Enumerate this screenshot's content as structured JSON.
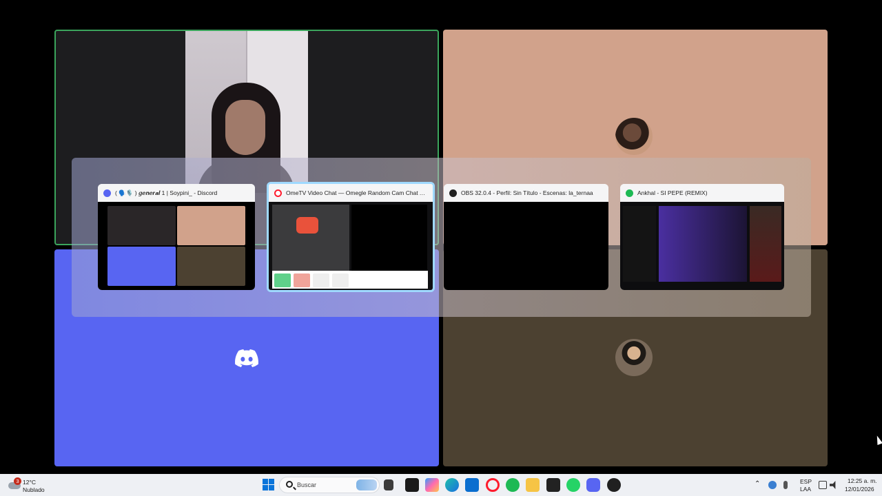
{
  "call": {
    "tiles": [
      {
        "name": "participant-camera",
        "color": "#1d1d1f",
        "speaking_outline": "#3ba55c"
      },
      {
        "name": "participant-avatar-pixel",
        "color": "#d1a28b"
      },
      {
        "name": "participant-discord-default",
        "color": "#5865f2"
      },
      {
        "name": "participant-avatar-glasses",
        "color": "#4c4131"
      }
    ]
  },
  "switcher": {
    "windows": [
      {
        "title": "( 🗣️🎙️ ) 𝒈𝒆𝒏𝒆𝒓𝒂𝒍 1 | Soypini_ - Discord",
        "icon": "discord-icon",
        "icon_color": "#5865f2",
        "selected": false
      },
      {
        "title": "OmeTV Video Chat — Omegle Random Cam Chat Alter...",
        "icon": "opera-icon",
        "icon_color": "#ff1b2d",
        "selected": true
      },
      {
        "title": "OBS 32.0.4 - Perfil: Sin Título - Escenas: la_ternaa",
        "icon": "obs-icon",
        "icon_color": "#202020",
        "selected": false
      },
      {
        "title": "Ankhal - SI PEPE (REMIX)",
        "icon": "spotify-icon",
        "icon_color": "#1db954",
        "selected": false
      }
    ],
    "ometv_thumb": {
      "logo_text": "Ome",
      "logo_sub": "TV"
    }
  },
  "taskbar": {
    "weather": {
      "temp": "12°C",
      "condition": "Nublado",
      "notif_count": "3"
    },
    "search_placeholder": "Buscar",
    "pinned": [
      "start-icon",
      "search-icon",
      "file-explorer-icon",
      "capcut-icon",
      "copilot-icon",
      "edge-icon",
      "microsoft-store-icon",
      "opera-icon",
      "spotify-icon",
      "folder-icon",
      "epic-games-icon",
      "whatsapp-icon",
      "discord-icon",
      "obs-icon"
    ],
    "tray": {
      "language": "ESP",
      "layout": "LAA",
      "time": "12:25 a. m.",
      "date": "12/01/2026"
    }
  }
}
